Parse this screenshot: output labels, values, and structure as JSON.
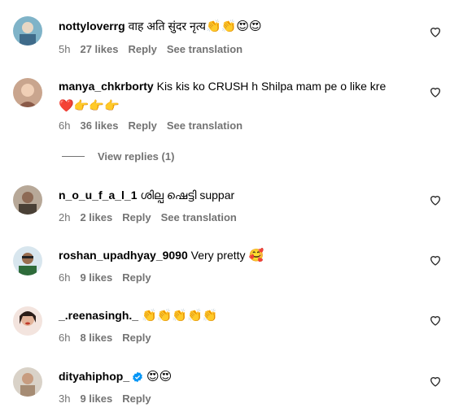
{
  "comments": [
    {
      "username": "nottyloverrg",
      "text": "वाह अति सुंदर नृत्य",
      "emojis": "👏👏😍😍",
      "time": "5h",
      "likes": "27 likes",
      "reply": "Reply",
      "translate": "See translation"
    },
    {
      "username": "manya_chkrborty",
      "text": "Kis kis ko CRUSH h Shilpa mam pe o like kre",
      "text2": "❤️👉👉👉",
      "time": "6h",
      "likes": "36 likes",
      "reply": "Reply",
      "translate": "See translation",
      "view_replies": "View replies (1)"
    },
    {
      "username": "n_o_u_f_a_l_1",
      "text": "ശില്പ ഷെട്ടി suppar",
      "time": "2h",
      "likes": "2 likes",
      "reply": "Reply",
      "translate": "See translation"
    },
    {
      "username": "roshan_upadhyay_9090",
      "text": "Very pretty",
      "emojis": "🥰",
      "time": "6h",
      "likes": "9 likes",
      "reply": "Reply"
    },
    {
      "username": "_.reenasingh._",
      "emojis": "👏👏👏👏👏",
      "time": "6h",
      "likes": "8 likes",
      "reply": "Reply"
    },
    {
      "username": "dityahiphop_",
      "emojis": "😍😍",
      "time": "3h",
      "likes": "9 likes",
      "reply": "Reply"
    }
  ],
  "colors": {
    "meta": "#737373",
    "verified": "#0095f6",
    "heart_stroke": "#262626"
  },
  "icons": {
    "like": "heart-outline-icon",
    "verified": "verified-badge-icon"
  }
}
